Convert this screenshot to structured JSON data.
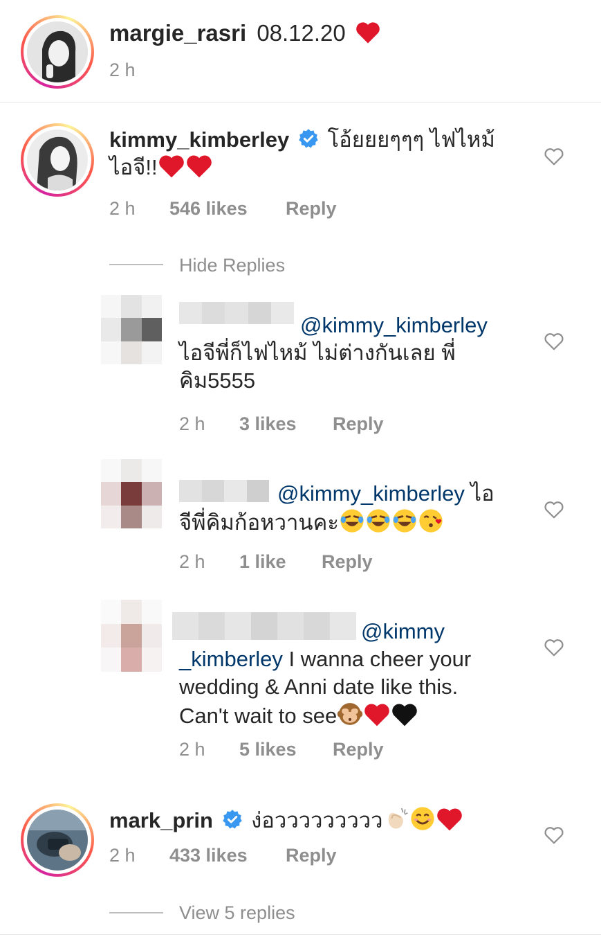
{
  "caption": {
    "username": "margie_rasri",
    "text": "08.12.20",
    "time": "2 h"
  },
  "comments": [
    {
      "username": "kimmy_kimberley",
      "verified": true,
      "text_line1": "โอ้ยยยๆๆๆ ไฟไหม้",
      "text_line2": "ไอจี!!",
      "time": "2 h",
      "likes": "546 likes",
      "reply": "Reply",
      "toggle": "Hide Replies"
    },
    {
      "username": "mark_prin",
      "verified": true,
      "text": "ง่อววววววววว",
      "time": "2 h",
      "likes": "433 likes",
      "reply": "Reply",
      "toggle": "View 5 replies"
    }
  ],
  "replies": [
    {
      "mention": "@kimmy_kimberley",
      "text_line1": "ไอจีพี่ก็ไฟไหม้ ไม่ต่างกันเลย พี่",
      "text_line2": "คิม5555",
      "time": "2 h",
      "likes": "3 likes",
      "reply": "Reply"
    },
    {
      "mention": "@kimmy_kimberley",
      "text_tail": "ไอ",
      "text_line2": "จีพี่คิมก้อหวานคะ",
      "time": "2 h",
      "likes": "1 like",
      "reply": "Reply"
    },
    {
      "mention_part1": "@kimmy",
      "mention_part2": "_kimberley",
      "text_tail": "I wanna cheer your",
      "text_line3": "wedding & Anni date like this.",
      "text_line4": "Can't wait to see",
      "time": "2 h",
      "likes": "5 likes",
      "reply": "Reply"
    }
  ],
  "colors": {
    "verified_blue": "#3897f0",
    "heart_red": "#e0162b",
    "mention": "#00376b",
    "meta_gray": "#8e8e8e"
  }
}
